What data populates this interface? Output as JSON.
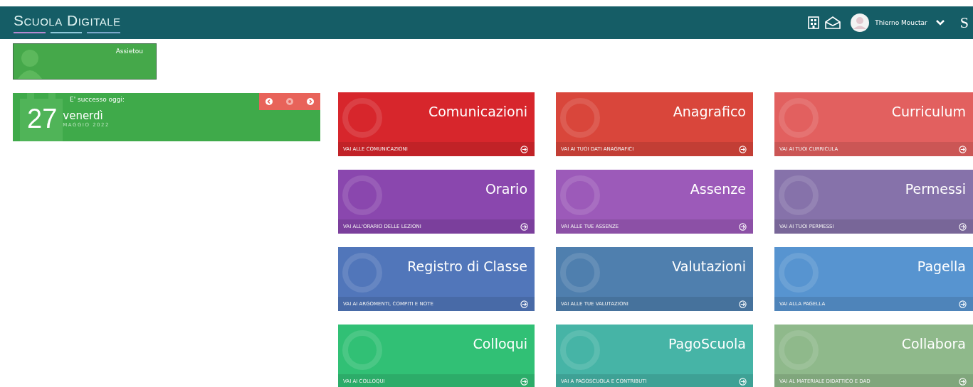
{
  "header": {
    "logo": "Scuola Digitale",
    "user_name": "Thierno Mouctar",
    "brand_mark": "S"
  },
  "user_card": {
    "name": "Assietou"
  },
  "today_card": {
    "caption": "E' successo oggi:",
    "day": "27",
    "weekday": "venerdì",
    "month_year": "MAGGIO 2022"
  },
  "tiles": [
    {
      "title": "Comunicazioni",
      "link": "VAI ALLE COMUNICAZIONI",
      "color": "#d7262c"
    },
    {
      "title": "Anagrafico",
      "link": "VAI AI TUOI DATI ANAGRAFICI",
      "color": "#d9463b"
    },
    {
      "title": "Curriculum",
      "link": "VAI AI TUOI CURRICULA",
      "color": "#e2605f"
    },
    {
      "title": "Orario",
      "link": "VAI ALL'ORARIO DELLE LEZIONI",
      "color": "#8a47ae"
    },
    {
      "title": "Assenze",
      "link": "VAI ALLE TUE ASSENZE",
      "color": "#9c5ab9"
    },
    {
      "title": "Permessi",
      "link": "VAI AI TUOI PERMESSI",
      "color": "#8672aa"
    },
    {
      "title": "Registro di Classe",
      "link": "VAI AI ARGOMENTI, COMPITI E NOTE",
      "color": "#5176ba"
    },
    {
      "title": "Valutazioni",
      "link": "VAI ALLE TUE VALUTAZIONI",
      "color": "#4f7fae"
    },
    {
      "title": "Pagella",
      "link": "VAI ALLA PAGELLA",
      "color": "#5794d0"
    },
    {
      "title": "Colloqui",
      "link": "VAI AI COLLOQUI",
      "color": "#31c075"
    },
    {
      "title": "PagoScuola",
      "link": "VAI A PAGOSCUOLA E CONTRIBUTI",
      "color": "#46b4a6"
    },
    {
      "title": "Collabora",
      "link": "VAI AL MATERIALE DIDATTICO E DAD",
      "color": "#8fb98b"
    }
  ]
}
